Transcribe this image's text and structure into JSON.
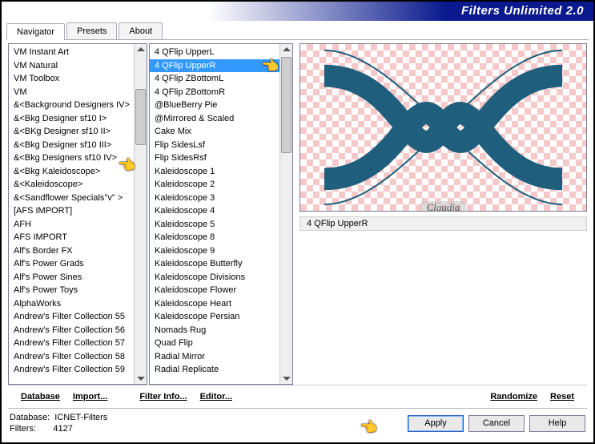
{
  "app": {
    "title": "Filters Unlimited 2.0"
  },
  "tabs": [
    "Navigator",
    "Presets",
    "About"
  ],
  "activeTab": 0,
  "categoryList": [
    "VM Instant Art",
    "VM Natural",
    "VM Toolbox",
    "VM",
    "&<Background Designers IV>",
    "&<Bkg Designer sf10 I>",
    "&<BKg Designer sf10 II>",
    "&<Bkg Designer sf10 III>",
    "&<Bkg Designers sf10 IV>",
    "&<Bkg Kaleidoscope>",
    "&<Kaleidoscope>",
    "&<Sandflower Specials\"v\" >",
    "[AFS IMPORT]",
    "AFH",
    "AFS IMPORT",
    "Alf's Border FX",
    "Alf's Power Grads",
    "Alf's Power Sines",
    "Alf's Power Toys",
    "AlphaWorks",
    "Andrew's Filter Collection 55",
    "Andrew's Filter Collection 56",
    "Andrew's Filter Collection 57",
    "Andrew's Filter Collection 58",
    "Andrew's Filter Collection 59"
  ],
  "categorySelectedIndex": 9,
  "filterList": [
    "4 QFlip UpperL",
    "4 QFlip UpperR",
    "4 QFlip ZBottomL",
    "4 QFlip ZBottomR",
    "@BlueBerry Pie",
    "@Mirrored & Scaled",
    "Cake Mix",
    "Flip SidesLsf",
    "Flip SidesRsf",
    "Kaleidoscope 1",
    "Kaleidoscope 2",
    "Kaleidoscope 3",
    "Kaleidoscope 4",
    "Kaleidoscope 5",
    "Kaleidoscope 8",
    "Kaleidoscope 9",
    "Kaleidoscope Butterfly",
    "Kaleidoscope Divisions",
    "Kaleidoscope Flower",
    "Kaleidoscope Heart",
    "Kaleidoscope Persian",
    "Nomads Rug",
    "Quad Flip",
    "Radial Mirror",
    "Radial Replicate"
  ],
  "filterSelectedIndex": 1,
  "preview": {
    "watermark": "Claudia",
    "selectedFilterName": "4 QFlip UpperR"
  },
  "linkButtons": {
    "database": "Database",
    "import": "Import...",
    "filterInfo": "Filter Info...",
    "editor": "Editor...",
    "randomize": "Randomize",
    "reset": "Reset"
  },
  "footer": {
    "dbLabel": "Database:",
    "dbName": "ICNET-Filters",
    "filtersLabel": "Filters:",
    "filtersCount": "4127"
  },
  "mainButtons": {
    "apply": "Apply",
    "cancel": "Cancel",
    "help": "Help"
  }
}
